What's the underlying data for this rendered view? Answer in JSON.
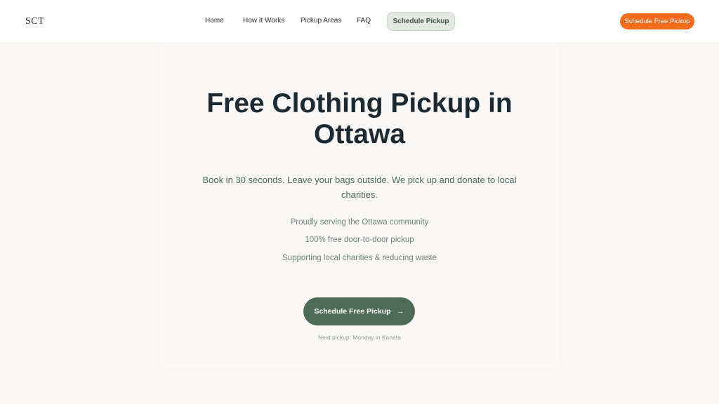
{
  "brand": {
    "logo_text": "SCT"
  },
  "nav": {
    "items": [
      "Home",
      "How It Works",
      "Pickup Areas",
      "FAQ"
    ],
    "active_label": "Schedule Pickup",
    "cta_label": "Schedule Free Pickup"
  },
  "hero": {
    "headline_line1": "Free Clothing Pickup in",
    "headline_line2": "Ottawa",
    "subtitle": "Book in 30 seconds. Leave your bags outside. We pick up and donate to local charities.",
    "features": [
      "Proudly serving the Ottawa community",
      "100% free door-to-door pickup",
      "Supporting local charities & reducing waste"
    ],
    "cta_label": "Schedule Free Pickup",
    "cta_icon": "arrow-right-icon",
    "next_pickup": "Next pickup: Monday in Kanata"
  },
  "colors": {
    "accent_orange": "#f26c1c",
    "primary_green": "#4e6b57",
    "background": "#f8f6f3",
    "text_dark": "#1f2a30"
  }
}
